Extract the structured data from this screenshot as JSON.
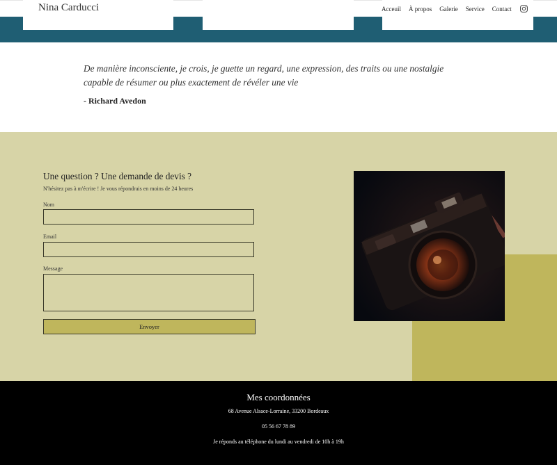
{
  "header": {
    "brand": "Nina Carducci",
    "nav": [
      "Acceuil",
      "À propos",
      "Galerie",
      "Service",
      "Contact"
    ],
    "social_icon": "instagram-icon",
    "colors": {
      "band": "#1f5e73"
    }
  },
  "quote": {
    "text": "De manière inconsciente, je crois, je guette un regard, une expression, des traits ou une nostalgie capable de résumer ou plus exactement de révéler une vie",
    "author": "- Richard Avedon"
  },
  "contact": {
    "title": "Une question ? Une demande de devis ?",
    "subtitle": "N'hésitez pas à m'écrire ! Je vous répondrais en moins de 24 heures",
    "fields": {
      "name_label": "Nom",
      "email_label": "Email",
      "message_label": "Message"
    },
    "submit_label": "Envoyer",
    "colors": {
      "background": "#d7d4a7",
      "accent": "#bfb65c"
    }
  },
  "footer": {
    "title": "Mes coordonnées",
    "address": "68 Avenue Alsace-Lorraine, 33200 Bordeaux",
    "phone": "05 56 67 78 89",
    "hours": "Je réponds au téléphone du lundi au vendredi de 10h à 19h"
  }
}
